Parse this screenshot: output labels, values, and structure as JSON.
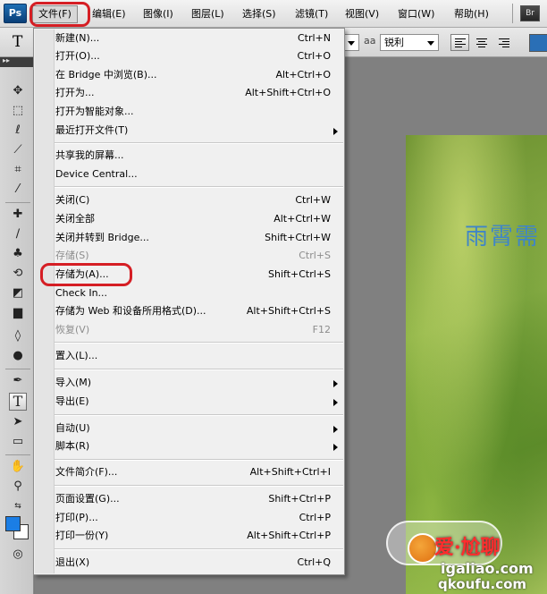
{
  "app": {
    "logo": "Ps",
    "bridge_logo": "Br"
  },
  "menubar": {
    "items": [
      "文件(F)",
      "编辑(E)",
      "图像(I)",
      "图层(L)",
      "选择(S)",
      "滤镜(T)",
      "视图(V)",
      "窗口(W)",
      "帮助(H)"
    ]
  },
  "options": {
    "tool_letter": "T",
    "aa_label": "aa",
    "aa_value": "锐利"
  },
  "tools": [
    "move-icon",
    "marquee-icon",
    "lasso-icon",
    "magic-wand-icon",
    "crop-icon",
    "eyedropper-icon",
    "healing-brush-icon",
    "brush-icon",
    "clone-stamp-icon",
    "history-brush-icon",
    "eraser-icon",
    "gradient-icon",
    "blur-icon",
    "dodge-icon",
    "pen-icon",
    "type-icon",
    "path-selection-icon",
    "shape-icon",
    "hand-icon",
    "zoom-icon"
  ],
  "tool_selected": "T",
  "colors": {
    "foreground": "#1b7ee5",
    "background": "#ffffff",
    "highlight": "#d51e24"
  },
  "file_menu": {
    "items": [
      {
        "label": "新建(N)...",
        "shortcut": "Ctrl+N"
      },
      {
        "label": "打开(O)...",
        "shortcut": "Ctrl+O"
      },
      {
        "label": "在 Bridge 中浏览(B)...",
        "shortcut": "Alt+Ctrl+O"
      },
      {
        "label": "打开为...",
        "shortcut": "Alt+Shift+Ctrl+O"
      },
      {
        "label": "打开为智能对象...",
        "shortcut": ""
      },
      {
        "label": "最近打开文件(T)",
        "shortcut": ""
      },
      {
        "label": "共享我的屏幕...",
        "shortcut": ""
      },
      {
        "label": "Device Central...",
        "shortcut": ""
      },
      {
        "label": "关闭(C)",
        "shortcut": "Ctrl+W"
      },
      {
        "label": "关闭全部",
        "shortcut": "Alt+Ctrl+W"
      },
      {
        "label": "关闭并转到 Bridge...",
        "shortcut": "Shift+Ctrl+W"
      },
      {
        "label": "存储(S)",
        "shortcut": "Ctrl+S"
      },
      {
        "label": "存储为(A)...",
        "shortcut": "Shift+Ctrl+S"
      },
      {
        "label": "Check In...",
        "shortcut": ""
      },
      {
        "label": "存储为 Web 和设备所用格式(D)...",
        "shortcut": "Alt+Shift+Ctrl+S"
      },
      {
        "label": "恢复(V)",
        "shortcut": "F12"
      },
      {
        "label": "置入(L)...",
        "shortcut": ""
      },
      {
        "label": "导入(M)",
        "shortcut": ""
      },
      {
        "label": "导出(E)",
        "shortcut": ""
      },
      {
        "label": "自动(U)",
        "shortcut": ""
      },
      {
        "label": "脚本(R)",
        "shortcut": ""
      },
      {
        "label": "文件简介(F)...",
        "shortcut": "Alt+Shift+Ctrl+I"
      },
      {
        "label": "页面设置(G)...",
        "shortcut": "Shift+Ctrl+P"
      },
      {
        "label": "打印(P)...",
        "shortcut": "Ctrl+P"
      },
      {
        "label": "打印一份(Y)",
        "shortcut": "Alt+Shift+Ctrl+P"
      },
      {
        "label": "退出(X)",
        "shortcut": "Ctrl+Q"
      }
    ]
  },
  "canvas": {
    "photo_text": "雨霄需",
    "watermark_line1": "爱·尬聊",
    "watermark_site": "igaliao.com",
    "watermark_site2": "qkoufu.com"
  }
}
